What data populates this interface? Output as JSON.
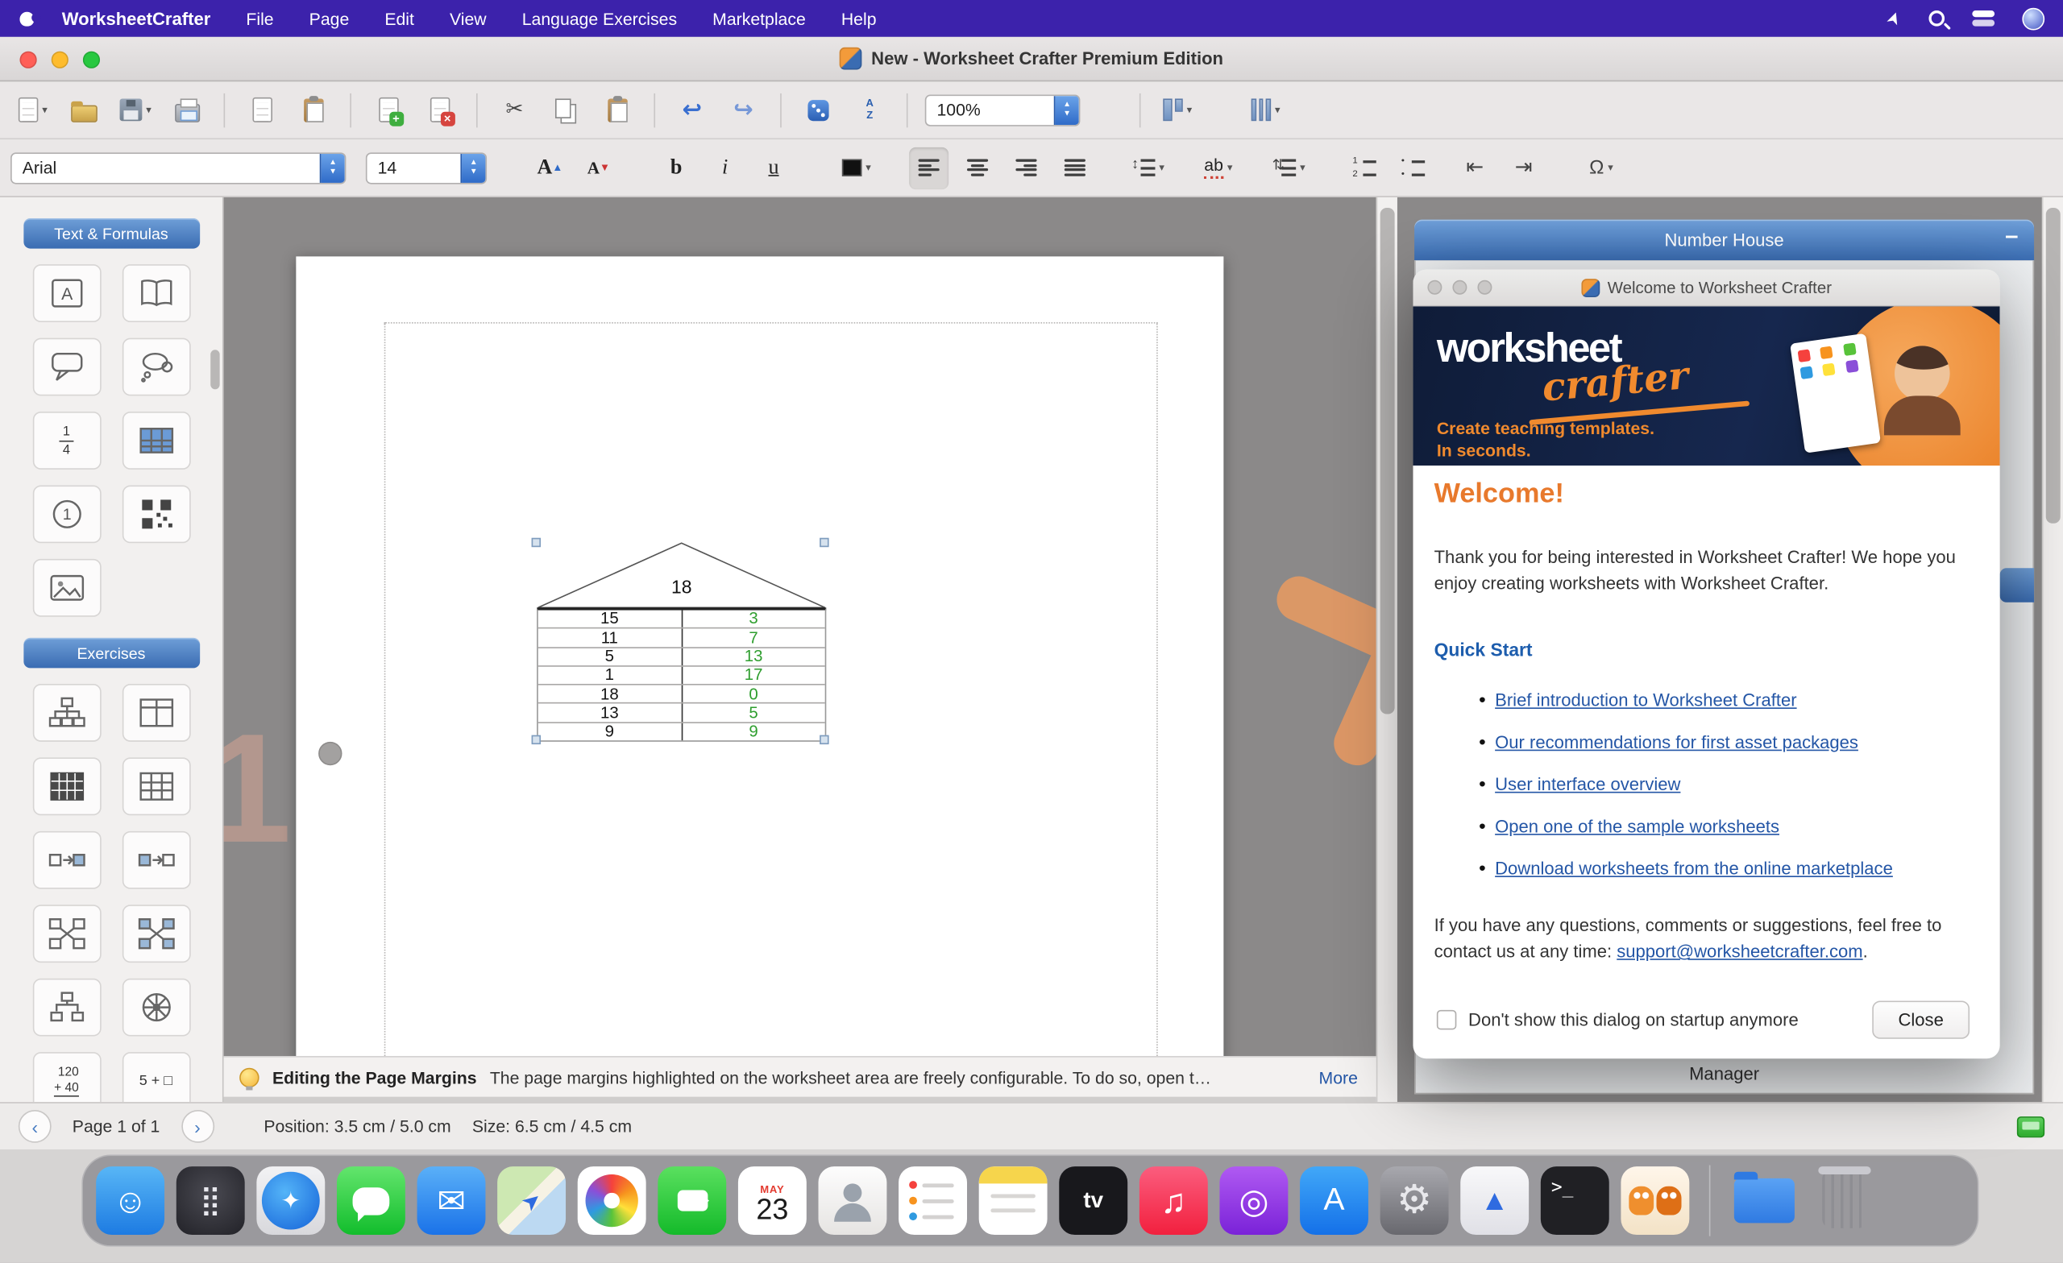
{
  "menu_bar": {
    "app_name": "WorksheetCrafter",
    "items": [
      "File",
      "Page",
      "Edit",
      "View",
      "Language Exercises",
      "Marketplace",
      "Help"
    ]
  },
  "window": {
    "title": "New - Worksheet Crafter Premium Edition"
  },
  "toolbar": {
    "zoom_value": "100%"
  },
  "format_bar": {
    "font_name": "Arial",
    "font_size": "14",
    "bold": "b",
    "italic": "i",
    "underline": "u",
    "grow": "A",
    "shrink": "A",
    "ab": "ab",
    "omega": "Ω"
  },
  "sidebar": {
    "sections": [
      {
        "title": "Text & Formulas"
      },
      {
        "title": "Exercises"
      }
    ],
    "fraction": {
      "top": "1",
      "bottom": "4"
    },
    "sum_icon": {
      "line1": "120",
      "line2": "+ 40"
    },
    "plus_box_icon": "5 + □",
    "circle_one": "1",
    "frame_letter": "A"
  },
  "canvas": {
    "number_house": {
      "roof": "18",
      "rows": [
        [
          "15",
          "3"
        ],
        [
          "11",
          "7"
        ],
        [
          "5",
          "13"
        ],
        [
          "1",
          "17"
        ],
        [
          "18",
          "0"
        ],
        [
          "13",
          "5"
        ],
        [
          "9",
          "9"
        ]
      ]
    }
  },
  "right_panel": {
    "title": "Number House",
    "minimize": "–",
    "partial_text": "Manager"
  },
  "dialog": {
    "title": "Welcome to Worksheet Crafter",
    "banner": {
      "logo_top": "worksheet",
      "logo_script": "crafter",
      "tagline1": "Create teaching templates.",
      "tagline2": "In seconds."
    },
    "heading": "Welcome!",
    "intro": "Thank you for being interested in Worksheet Crafter! We hope you enjoy creating worksheets with Worksheet Crafter.",
    "quick_start": "Quick Start",
    "bullet": "•",
    "links": [
      "Brief introduction to Worksheet Crafter",
      "Our recommendations for first asset packages",
      "User interface overview",
      "Open one of the sample worksheets",
      "Download worksheets from the online marketplace"
    ],
    "contact_pre": "If you have any questions, comments or suggestions, feel free to contact us at any time: ",
    "contact_email": "support@worksheetcrafter.com",
    "contact_post": ".",
    "checkbox_label": "Don't show this dialog on startup anymore",
    "close_label": "Close"
  },
  "tip_bar": {
    "title": "Editing the Page Margins",
    "text": "The page margins highlighted on the worksheet area are freely configurable. To do so, open t…",
    "more": "More"
  },
  "status_bar": {
    "page": "Page 1 of 1",
    "position": "Position: 3.5 cm / 5.0 cm",
    "size": "Size: 6.5 cm / 4.5 cm"
  },
  "dock": {
    "calendar_month": "MAY",
    "calendar_day": "23",
    "apps": [
      {
        "name": "finder",
        "glyph": "☺"
      },
      {
        "name": "launchpad",
        "glyph": "⣿"
      },
      {
        "name": "safari",
        "glyph": "✦"
      },
      {
        "name": "messages",
        "glyph": ""
      },
      {
        "name": "mail",
        "glyph": "✉"
      },
      {
        "name": "maps",
        "glyph": "➤"
      },
      {
        "name": "photos",
        "glyph": ""
      },
      {
        "name": "facetime",
        "glyph": ""
      },
      {
        "name": "calendar",
        "glyph": ""
      },
      {
        "name": "contacts",
        "glyph": ""
      },
      {
        "name": "reminders",
        "glyph": ""
      },
      {
        "name": "notes",
        "glyph": ""
      },
      {
        "name": "appletv",
        "glyph": "tv"
      },
      {
        "name": "music",
        "glyph": "♫"
      },
      {
        "name": "podcasts",
        "glyph": "◎"
      },
      {
        "name": "appstore",
        "glyph": "A"
      },
      {
        "name": "settings",
        "glyph": "⚙"
      },
      {
        "name": "graphics-app",
        "glyph": "▲"
      },
      {
        "name": "terminal",
        "glyph": ">_"
      },
      {
        "name": "worksheetcrafter",
        "glyph": ""
      },
      {
        "name": "downloads",
        "glyph": ""
      },
      {
        "name": "trash",
        "glyph": ""
      }
    ]
  },
  "colors": {
    "menu_purple": "#3c22ab",
    "header_blue": "#3a6cb2",
    "link_blue": "#2456a6",
    "accent_orange": "#e8792c",
    "value_green": "#2e9e2e"
  }
}
